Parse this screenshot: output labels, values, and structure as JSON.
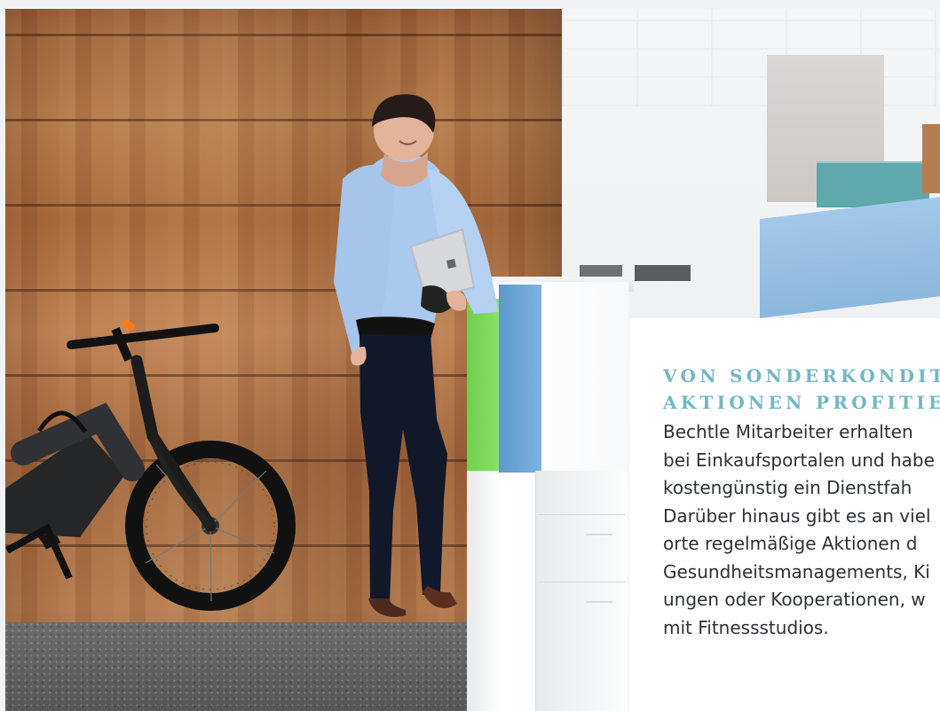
{
  "text_card": {
    "headline": [
      "VON SONDERKONDITIO",
      "AKTIONEN PROFITIER"
    ],
    "body": [
      "Bechtle Mitarbeiter erhalten",
      "bei Einkaufsportalen und habe",
      "kostengünstig ein Dienstfah",
      "Darüber hinaus gibt es an viel",
      "orte regelmäßige Aktionen d",
      "Gesundheitsmanagements, Ki",
      "ungen oder Kooperationen, w",
      "mit Fitnessstudios."
    ]
  },
  "colors": {
    "headline": "#72b8c3",
    "body_text": "#2d3035",
    "wood": "#b47a4a",
    "partition_green": "#79d85a",
    "partition_blue": "#6ea7d8",
    "teal_board": "#5fa8ac"
  }
}
